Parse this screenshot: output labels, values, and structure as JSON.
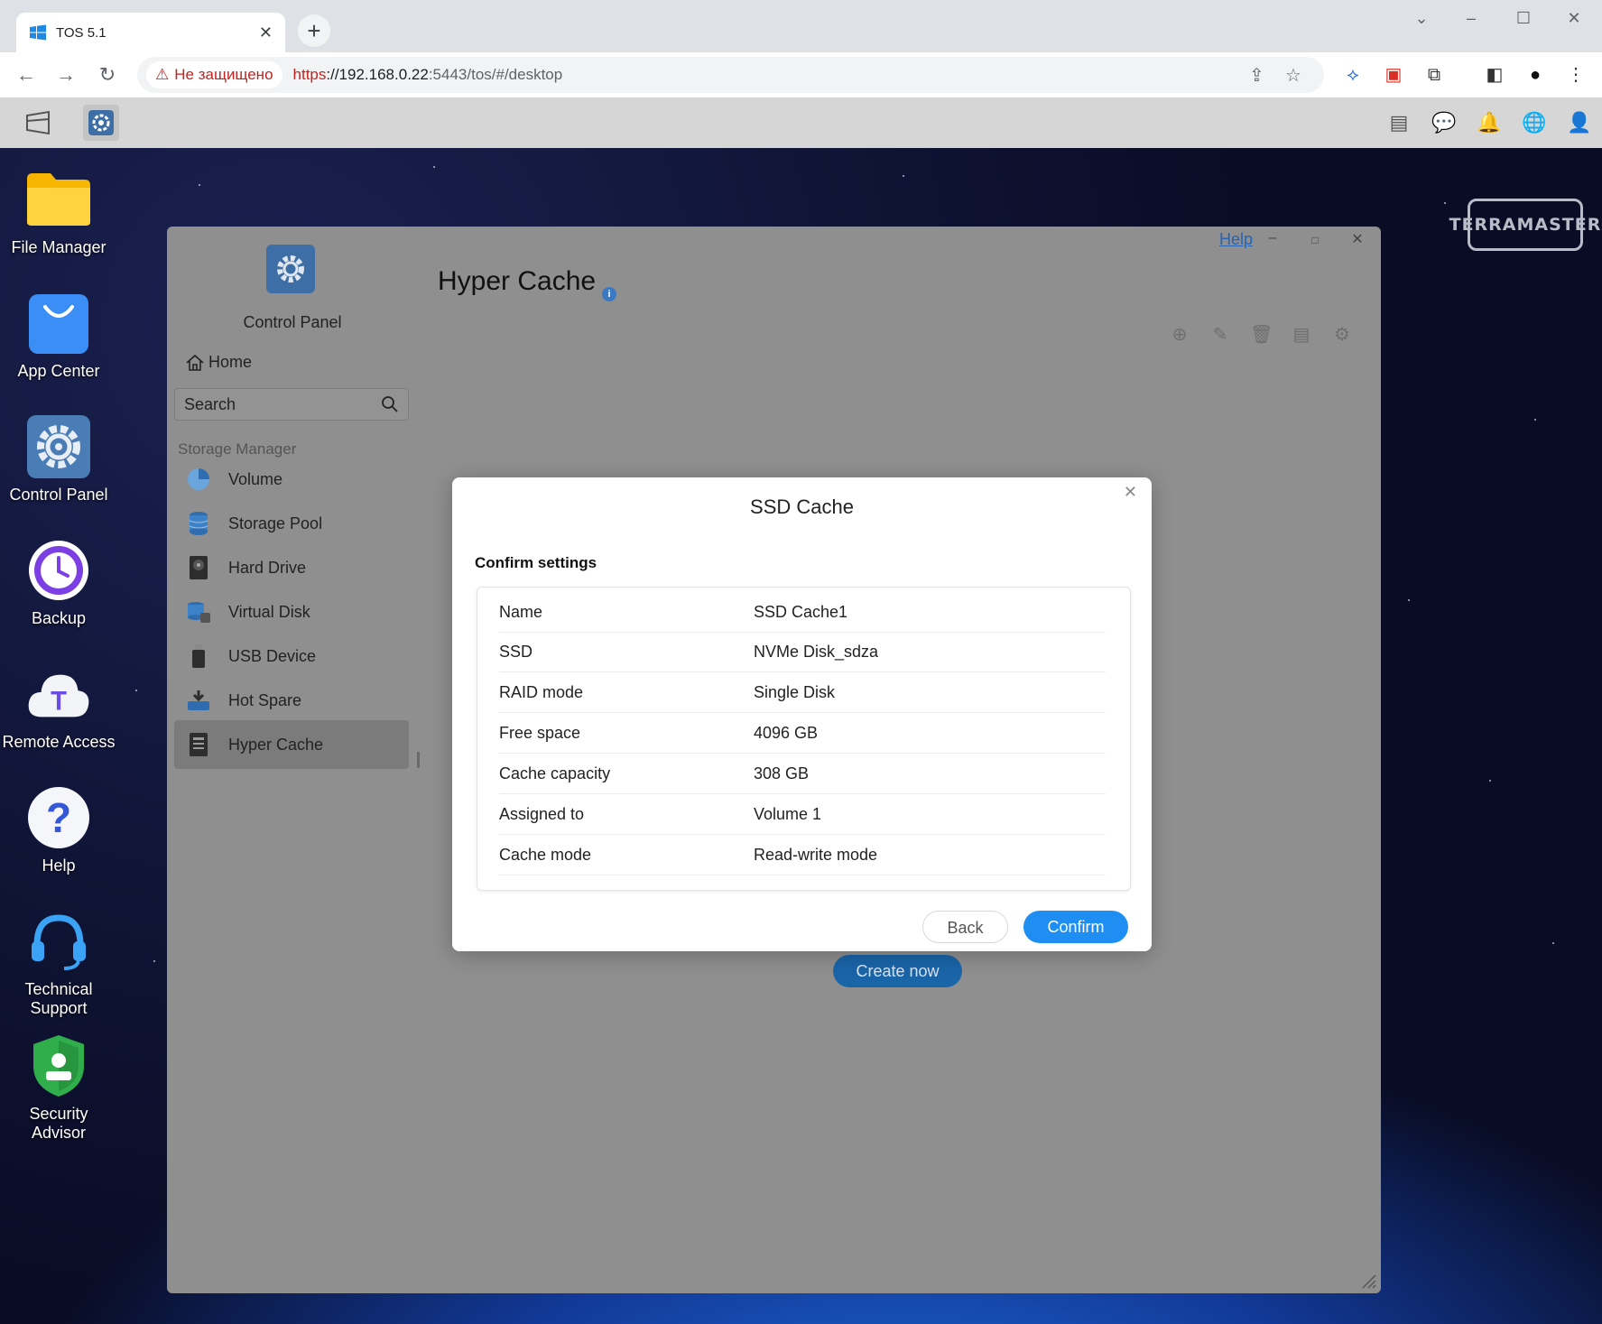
{
  "browser": {
    "tab_title": "TOS 5.1",
    "security_label": "Не защищено",
    "url_scheme": "https",
    "url_host": "://192.168.0.22",
    "url_path": ":5443/tos/#/desktop"
  },
  "desktop": {
    "brand": "TERRAMASTER",
    "icons": [
      {
        "label": "File Manager"
      },
      {
        "label": "App Center"
      },
      {
        "label": "Control Panel"
      },
      {
        "label": "Backup"
      },
      {
        "label": "Remote Access"
      },
      {
        "label": "Help"
      },
      {
        "label": "Technical Support"
      },
      {
        "label": "Security Advisor"
      }
    ]
  },
  "control_panel": {
    "title": "Control Panel",
    "home": "Home",
    "search_placeholder": "Search",
    "section": "Storage Manager",
    "items": [
      {
        "label": "Volume"
      },
      {
        "label": "Storage Pool"
      },
      {
        "label": "Hard Drive"
      },
      {
        "label": "Virtual Disk"
      },
      {
        "label": "USB Device"
      },
      {
        "label": "Hot Spare"
      },
      {
        "label": "Hyper Cache",
        "active": true
      }
    ],
    "page_title": "Hyper Cache",
    "help_link": "Help",
    "create_now": "Create now"
  },
  "modal": {
    "title": "SSD Cache",
    "subtitle": "Confirm settings",
    "rows": [
      {
        "key": "Name",
        "value": "SSD Cache1"
      },
      {
        "key": "SSD",
        "value": "NVMe Disk_sdza"
      },
      {
        "key": "RAID mode",
        "value": "Single Disk"
      },
      {
        "key": "Free space",
        "value": "4096 GB"
      },
      {
        "key": "Cache capacity",
        "value": "308 GB"
      },
      {
        "key": "Assigned to",
        "value": "Volume 1"
      },
      {
        "key": "Cache mode",
        "value": "Read-write mode"
      }
    ],
    "back_label": "Back",
    "confirm_label": "Confirm"
  },
  "colors": {
    "accent": "#1e8ef2",
    "warning": "#c5221f"
  }
}
